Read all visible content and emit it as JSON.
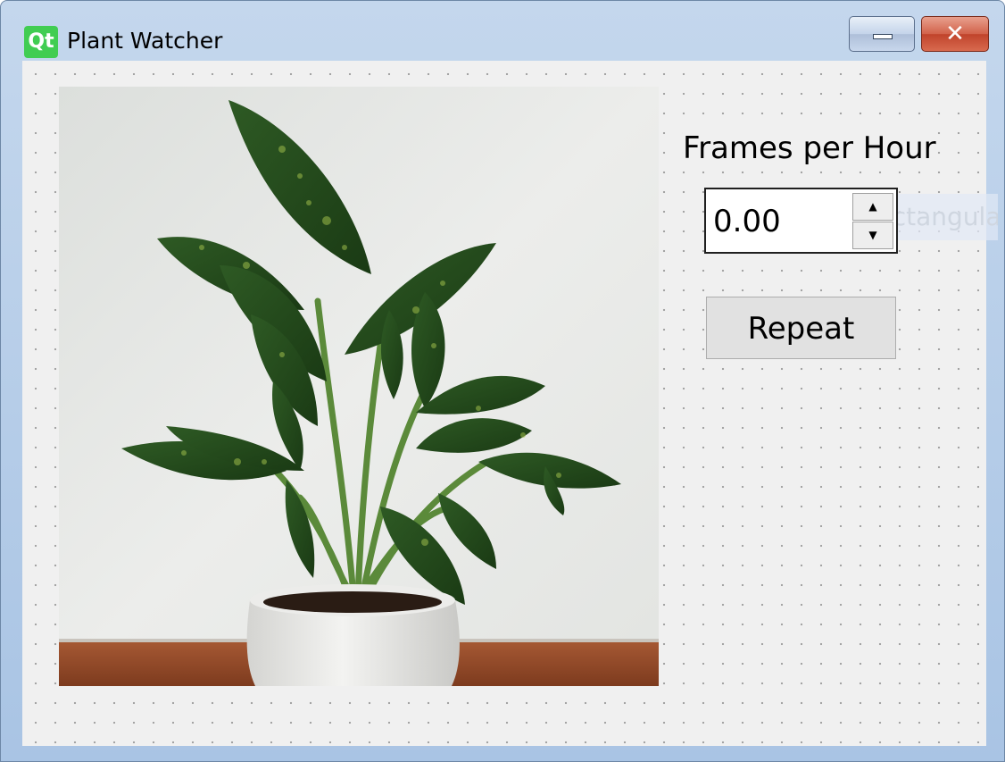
{
  "window": {
    "title": "Plant Watcher",
    "logo_text": "Qt",
    "close_glyph": "✕"
  },
  "controls": {
    "frames_label": "Frames per Hour",
    "frames_value": "0.00",
    "spin_up_glyph": "▲",
    "spin_down_glyph": "▼",
    "repeat_label": "Repeat",
    "ghost_text": "● Rectangula"
  },
  "image": {
    "subject": "potted dieffenbachia plant on wooden shelf against white wall"
  },
  "colors": {
    "qt_green": "#41cd52",
    "close_red": "#c8472d",
    "client_bg": "#f0f0f0"
  }
}
